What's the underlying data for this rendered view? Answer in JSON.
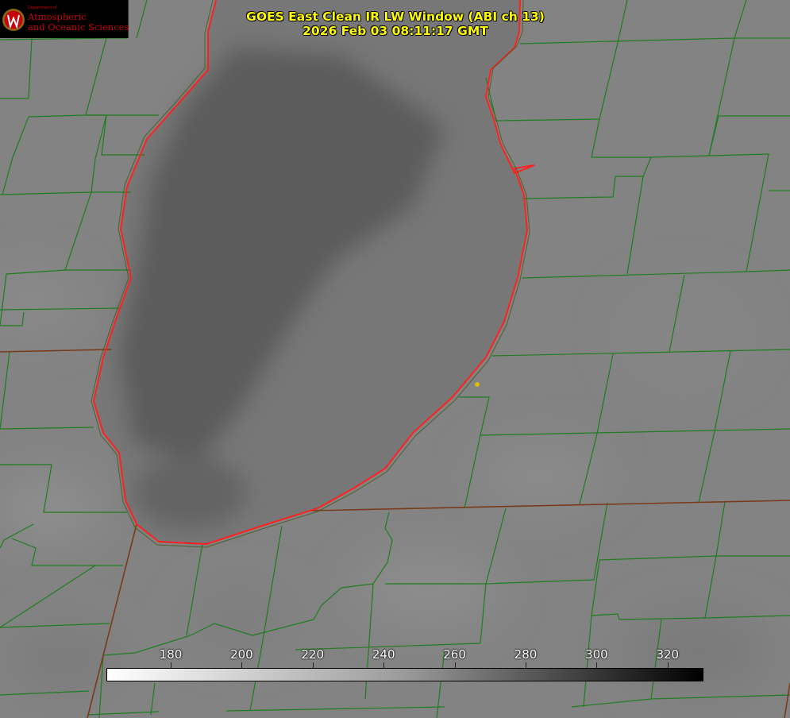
{
  "header": {
    "title_line1": "GOES East Clean IR LW Window (ABI ch 13)",
    "title_line2": "2026 Feb 03 08:11:17 GMT",
    "text_color": "#ffff00"
  },
  "logo": {
    "seal_letter": "W",
    "dept_small": "Department of",
    "line1": "Atmospheric",
    "line2": "and Oceanic Sciences",
    "brand_color": "#c5050c"
  },
  "colorbar": {
    "ticks": [
      "180",
      "200",
      "220",
      "240",
      "260",
      "280",
      "300",
      "320"
    ],
    "gradient": [
      "#ffffff",
      "#000000"
    ]
  },
  "map": {
    "boundary_color": "#1e7d1e",
    "state_line_color": "#7a3a1a",
    "shoreline_color": "#ff2020",
    "marker_color": "#d8c000",
    "lake_color": "#6c6c6c",
    "land_color": "#828282"
  }
}
